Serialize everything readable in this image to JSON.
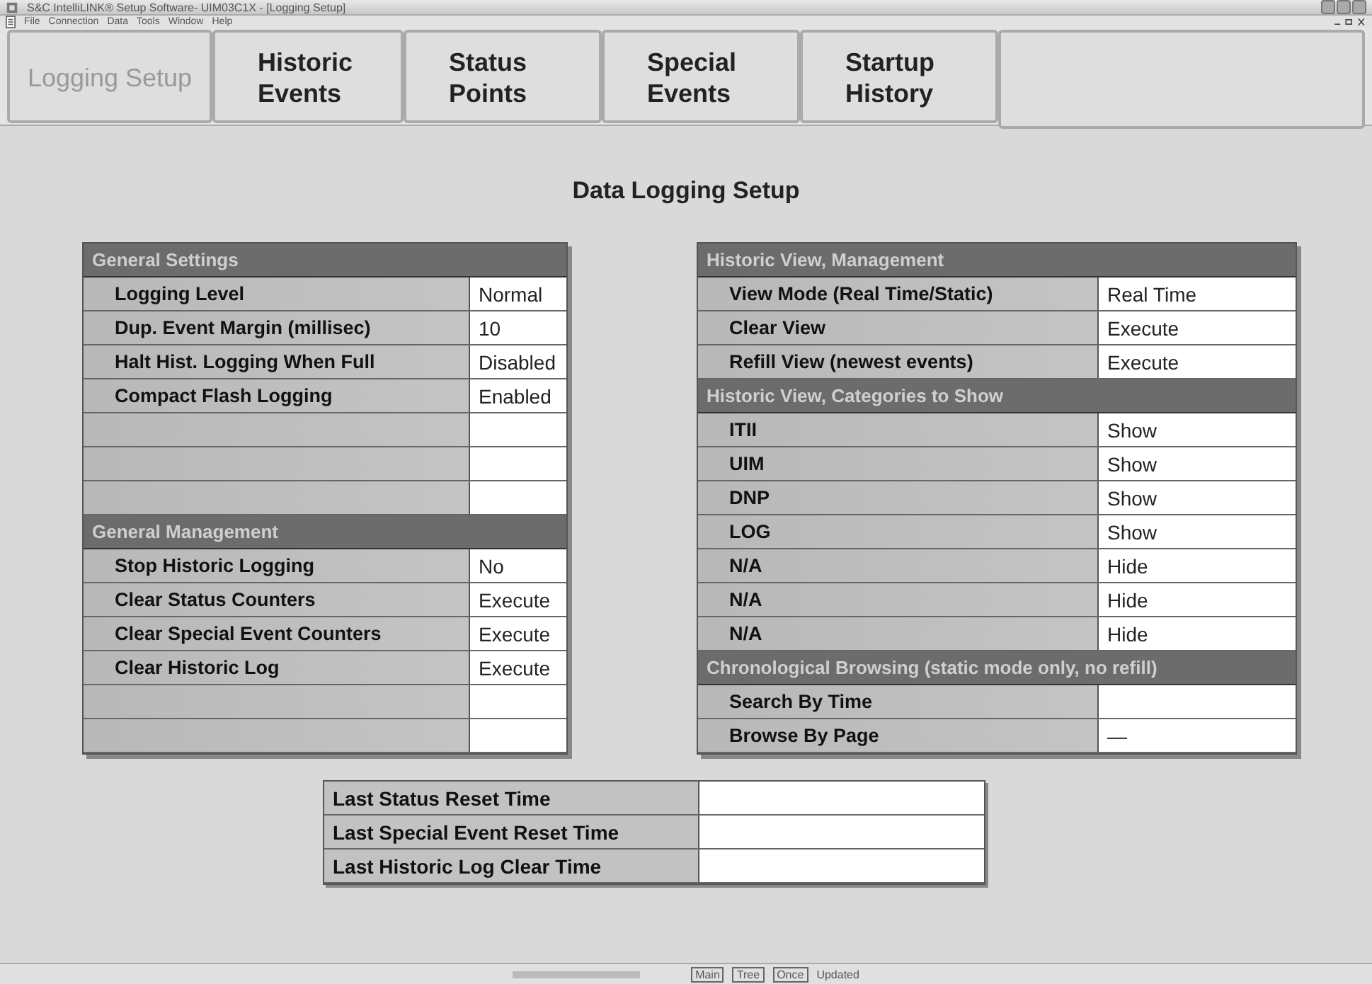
{
  "window": {
    "title": "S&C IntelliLINK® Setup Software- UIM03C1X - [Logging Setup]"
  },
  "menu": [
    "File",
    "Connection",
    "Data",
    "Tools",
    "Window",
    "Help"
  ],
  "tabs": [
    {
      "label": "Logging Setup",
      "selected": true
    },
    {
      "label": "Historic Events",
      "selected": false
    },
    {
      "label": "Status Points",
      "selected": false
    },
    {
      "label": "Special Events",
      "selected": false
    },
    {
      "label": "Startup History",
      "selected": false
    }
  ],
  "page_title": "Data Logging Setup",
  "left_panel": [
    {
      "heading": "General Settings",
      "rows": [
        {
          "kind": "setting",
          "label": "Logging Level",
          "value": "Normal"
        },
        {
          "kind": "setting",
          "label": "Dup. Event Margin (millisec)",
          "value": "10"
        },
        {
          "kind": "setting",
          "label": "Halt Hist. Logging When Full",
          "value": "Disabled"
        },
        {
          "kind": "setting",
          "label": "Compact Flash Logging",
          "value": "Enabled"
        },
        {
          "kind": "blank"
        },
        {
          "kind": "blank"
        },
        {
          "kind": "blank"
        }
      ]
    },
    {
      "heading": "General Management",
      "rows": [
        {
          "kind": "setting",
          "label": "Stop Historic Logging",
          "value": "No"
        },
        {
          "kind": "setting",
          "label": "Clear Status Counters",
          "value": "Execute"
        },
        {
          "kind": "setting",
          "label": "Clear Special Event Counters",
          "value": "Execute"
        },
        {
          "kind": "setting",
          "label": "Clear Historic Log",
          "value": "Execute"
        },
        {
          "kind": "blank"
        },
        {
          "kind": "blank"
        }
      ]
    }
  ],
  "right_panel": [
    {
      "heading": "Historic View, Management",
      "rows": [
        {
          "kind": "setting",
          "label": "View Mode (Real Time/Static)",
          "value": "Real Time"
        },
        {
          "kind": "setting",
          "label": "Clear View",
          "value": "Execute"
        },
        {
          "kind": "setting",
          "label": "Refill View (newest events)",
          "value": "Execute"
        }
      ]
    },
    {
      "heading": "Historic View, Categories to Show",
      "rows": [
        {
          "kind": "setting",
          "label": "ITII",
          "value": "Show"
        },
        {
          "kind": "setting",
          "label": "UIM",
          "value": "Show"
        },
        {
          "kind": "setting",
          "label": "DNP",
          "value": "Show"
        },
        {
          "kind": "setting",
          "label": "LOG",
          "value": "Show"
        },
        {
          "kind": "setting",
          "label": "N/A",
          "value": "Hide"
        },
        {
          "kind": "setting",
          "label": "N/A",
          "value": "Hide"
        },
        {
          "kind": "setting",
          "label": "N/A",
          "value": "Hide"
        }
      ]
    },
    {
      "heading": "Chronological Browsing (static mode only, no refill)",
      "rows": [
        {
          "kind": "setting",
          "label": "Search By Time"
        },
        {
          "kind": "setting",
          "label": "Browse By Page",
          "value": "—"
        }
      ]
    }
  ],
  "reset_times": [
    {
      "label": "Last Status Reset Time"
    },
    {
      "label": "Last Special Event Reset Time"
    },
    {
      "label": "Last Historic Log Clear Time"
    }
  ],
  "status_bar": [
    "Main",
    "Tree",
    "Once",
    "Updated"
  ]
}
